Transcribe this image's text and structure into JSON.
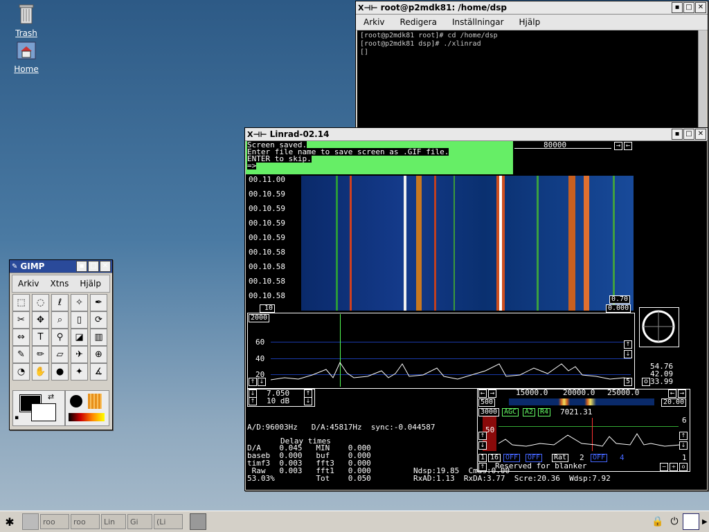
{
  "desktop": {
    "trash_label": "Trash",
    "home_label": "Home"
  },
  "terminal": {
    "title": "root@p2mdk81: /home/dsp",
    "menu": [
      "Arkiv",
      "Redigera",
      "Inställningar",
      "Hjälp"
    ],
    "lines": [
      "[root@p2mdk81 root]# cd /home/dsp",
      "[root@p2mdk81 dsp]# ./xlinrad",
      "[]"
    ]
  },
  "linrad": {
    "title": "Linrad-02.14",
    "msg": [
      "Screen saved.",
      "Enter file name to save screen as .GIF file.",
      "ENTER to skip.",
      "=>"
    ],
    "freq_top": "80000",
    "times": [
      "00.11.00",
      "00.10.59",
      "00.10.59",
      "00.10.59",
      "00.10.59",
      "00.10.58",
      "00.10.58",
      "00.10.58",
      "00.10.58",
      "00.10.58"
    ],
    "wf_left_box": "10",
    "wf_right_top": "0.70",
    "wf_right_bot": "0.000",
    "spec_top_box": "2000",
    "spec_ticks": [
      "60",
      "40",
      "20"
    ],
    "spec_right_box": "5",
    "side_values": [
      "54.76",
      "42.09",
      "33.99"
    ],
    "side_o": "o",
    "ctrl_a": "7.050",
    "ctrl_b": "10 dB",
    "status_line": "A/D:96003Hz   D/A:45817Hz  sync:-0.044587",
    "delay_header": "Delay times",
    "delay_rows": [
      "D/A    0.045   MIN    0.000",
      "baseb  0.000   buf    0.000",
      "timf3  0.003   fft3   0.000",
      " Raw   0.003   fft1   0.000",
      "53.03%         Tot    0.050"
    ],
    "ndsp_line": "Ndsp:19.85  Cmds:0.00",
    "rx_line": "RxAD:1.13  RxDA:3.77  Scre:20.36  Wdsp:7.92",
    "bf_freqs": [
      "15000.0",
      "20000.0",
      "25000.0"
    ],
    "bf_left": "500",
    "bf_right": "20.00",
    "bf_bar": [
      "3000",
      "AGC",
      "A2",
      "R4",
      "7021.31"
    ],
    "bf_six": "6",
    "bf_fifty": "50",
    "bf_row2": [
      "1",
      "16",
      "OFF",
      "OFF",
      "Rat",
      "2",
      "OFF",
      "4"
    ],
    "bf_one": "1",
    "blanker": "Reserved for blanker"
  },
  "gimp": {
    "title": "GIMP",
    "menu": [
      "Arkiv",
      "Xtns",
      "Hjälp"
    ],
    "tools": [
      "rect-select-icon",
      "ellipse-select-icon",
      "lasso-icon",
      "magic-wand-icon",
      "bezier-icon",
      "scissors-icon",
      "move-icon",
      "magnify-icon",
      "crop-icon",
      "transform-icon",
      "flip-icon",
      "text-icon",
      "color-picker-icon",
      "bucket-fill-icon",
      "gradient-icon",
      "pencil-icon",
      "paintbrush-icon",
      "eraser-icon",
      "airbrush-icon",
      "clone-icon",
      "dodge-icon",
      "smudge-icon",
      "ink-icon",
      "convolve-icon",
      "measure-icon"
    ],
    "tool_glyphs": [
      "⬚",
      "◌",
      "ℓ",
      "✧",
      "✒",
      "✂",
      "✥",
      "⌕",
      "▯",
      "⟳",
      "⇔",
      "T",
      "⚲",
      "◪",
      "▥",
      "✎",
      "✏",
      "▱",
      "✈",
      "⊕",
      "◔",
      "✋",
      "●",
      "✦",
      "∡"
    ]
  },
  "taskbar": {
    "tasks": [
      "roo",
      "roo",
      "Lin",
      "Gi",
      "(Li"
    ]
  }
}
